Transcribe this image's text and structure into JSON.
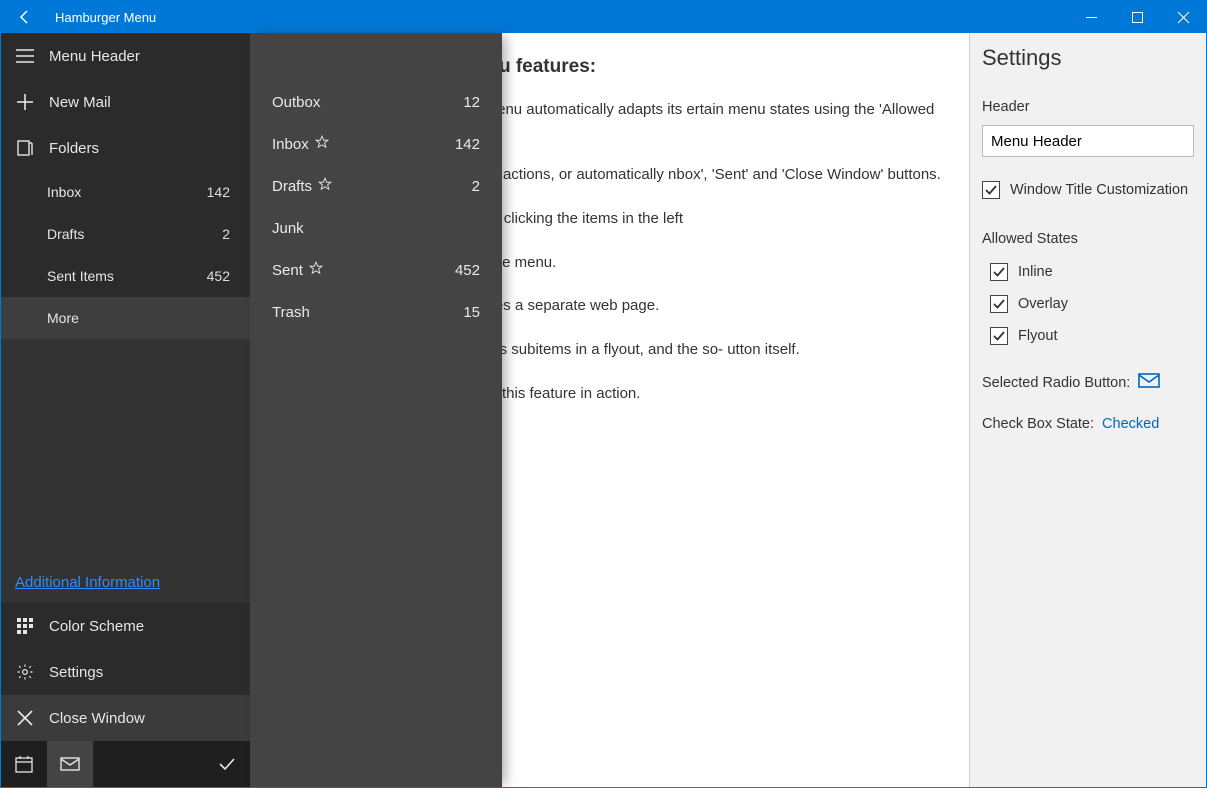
{
  "window": {
    "title": "Hamburger Menu"
  },
  "sidebar": {
    "header": "Menu Header",
    "newMail": "New Mail",
    "folders": "Folders",
    "children": [
      {
        "label": "Inbox",
        "count": "142"
      },
      {
        "label": "Drafts",
        "count": "2"
      },
      {
        "label": "Sent Items",
        "count": "452"
      }
    ],
    "more": "More",
    "additionalInfo": "Additional Information",
    "colorScheme": "Color Scheme",
    "settings": "Settings",
    "closeWindow": "Close Window"
  },
  "flyout": {
    "items": [
      {
        "label": "Outbox",
        "count": "12",
        "star": false
      },
      {
        "label": "Inbox",
        "count": "142",
        "star": true
      },
      {
        "label": "Drafts",
        "count": "2",
        "star": true
      },
      {
        "label": "Junk",
        "count": "",
        "star": false
      },
      {
        "label": "Sent",
        "count": "452",
        "star": true
      },
      {
        "label": "Trash",
        "count": "15",
        "star": false
      }
    ]
  },
  "content": {
    "heading": "ollowing Hamburger Menu features:",
    "p1": "dow to see how the Hamburger Menu automatically adapts its ertain menu states using the 'Allowed States' check list on the right",
    "p2": "ons can be used to invoke custom actions, or automatically nbox', 'Sent' and 'Close Window' buttons.",
    "p3": "menu items into a radio group. Try clicking the items in the left",
    "p4": "tem in the right-bottom corner of the menu.",
    "p5": "nal Information' link, which activates a separate web page.",
    "p6": "u item, which provides access to its subitems in a flyout, and the so- utton itself.",
    "p7": "Press the 'New Mail' button to see this feature in action."
  },
  "settings": {
    "title": "Settings",
    "headerLabel": "Header",
    "headerValue": "Menu Header",
    "winTitle": "Window Title Customization",
    "allowedStates": "Allowed States",
    "states": {
      "inline": "Inline",
      "overlay": "Overlay",
      "flyout": "Flyout"
    },
    "selectedRadioLabel": "Selected Radio Button:",
    "checkboxLabel": "Check Box State:",
    "checkboxValue": "Checked"
  }
}
